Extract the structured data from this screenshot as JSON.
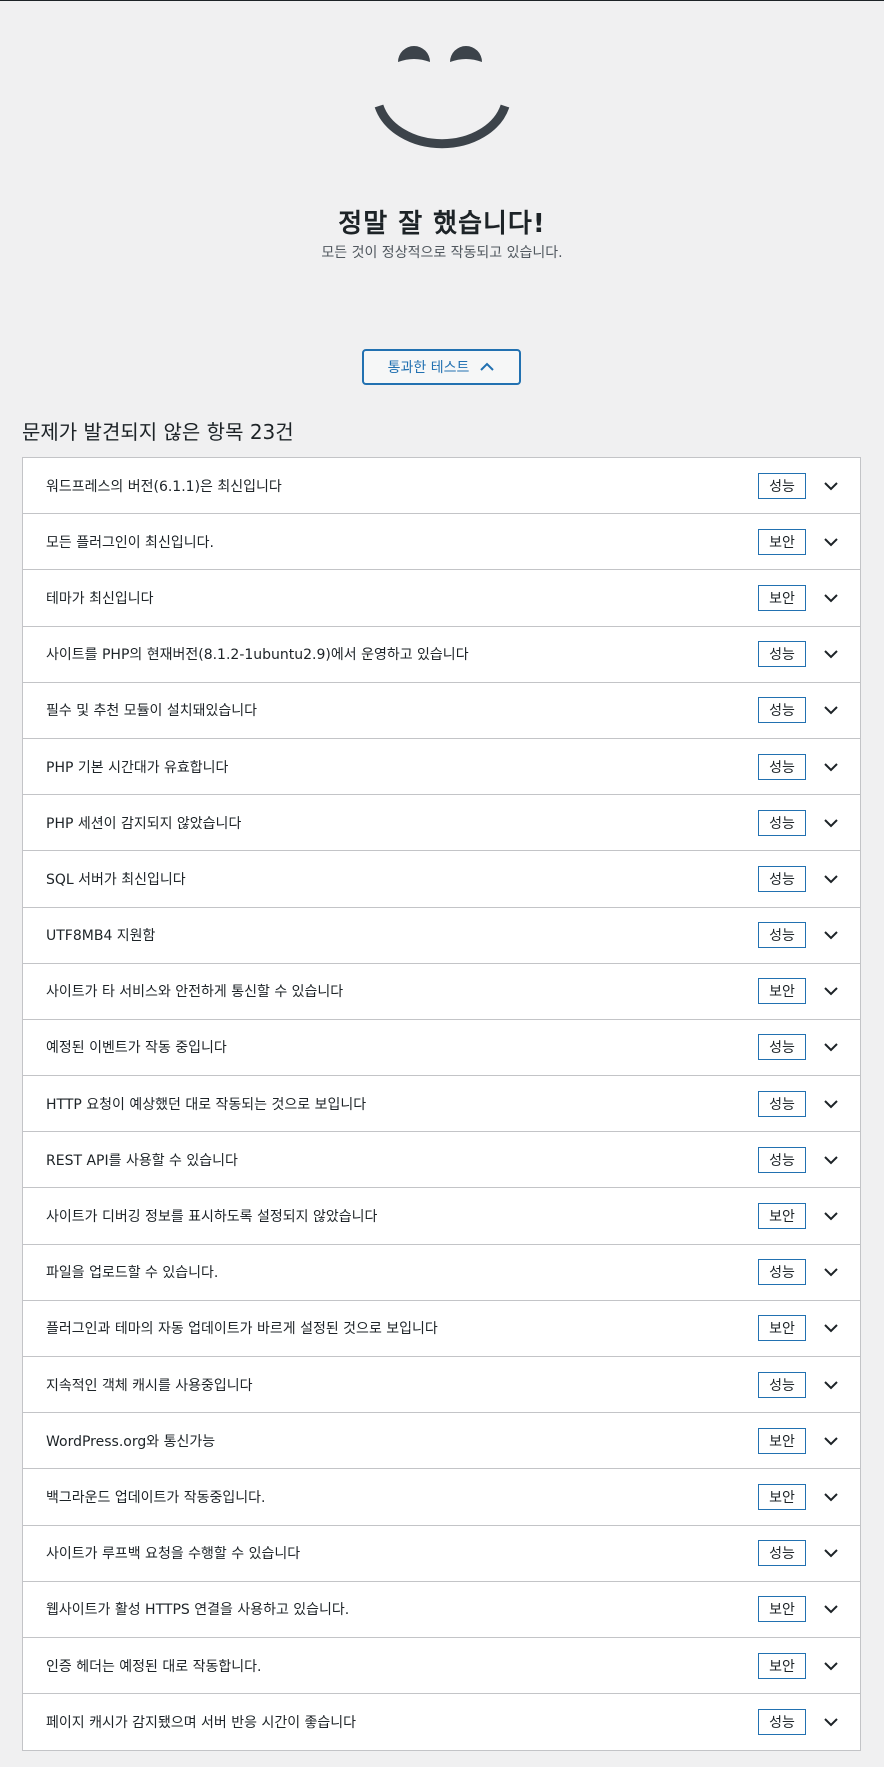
{
  "hero": {
    "title": "정말 잘 했습니다!",
    "subtitle": "모든 것이 정상적으로 작동되고 있습니다.",
    "icon": "smiley-icon"
  },
  "toggle_button": {
    "label": "통과한 테스트",
    "icon": "chevron-up-icon"
  },
  "section": {
    "heading": "문제가 발견되지 않은 항목 23건"
  },
  "colors": {
    "accent": "#2271b1",
    "background": "#f0f0f1",
    "text": "#1d2327",
    "border": "#c3c4c7"
  },
  "items": [
    {
      "label": "워드프레스의 버전(6.1.1)은 최신입니다",
      "badge": "성능"
    },
    {
      "label": "모든 플러그인이 최신입니다.",
      "badge": "보안"
    },
    {
      "label": "테마가 최신입니다",
      "badge": "보안"
    },
    {
      "label": "사이트를 PHP의 현재버전(8.1.2-1ubuntu2.9)에서 운영하고 있습니다",
      "badge": "성능"
    },
    {
      "label": "필수 및 추천 모듈이 설치돼있습니다",
      "badge": "성능"
    },
    {
      "label": "PHP 기본 시간대가 유효합니다",
      "badge": "성능"
    },
    {
      "label": "PHP 세션이 감지되지 않았습니다",
      "badge": "성능"
    },
    {
      "label": "SQL 서버가 최신입니다",
      "badge": "성능"
    },
    {
      "label": "UTF8MB4 지원함",
      "badge": "성능"
    },
    {
      "label": "사이트가 타 서비스와 안전하게 통신할 수 있습니다",
      "badge": "보안"
    },
    {
      "label": "예정된 이벤트가 작동 중입니다",
      "badge": "성능"
    },
    {
      "label": "HTTP 요청이 예상했던 대로 작동되는 것으로 보입니다",
      "badge": "성능"
    },
    {
      "label": "REST API를 사용할 수 있습니다",
      "badge": "성능"
    },
    {
      "label": "사이트가 디버깅 정보를 표시하도록 설정되지 않았습니다",
      "badge": "보안"
    },
    {
      "label": "파일을 업로드할 수 있습니다.",
      "badge": "성능"
    },
    {
      "label": "플러그인과 테마의 자동 업데이트가 바르게 설정된 것으로 보입니다",
      "badge": "보안"
    },
    {
      "label": "지속적인 객체 캐시를 사용중입니다",
      "badge": "성능"
    },
    {
      "label": "WordPress.org와 통신가능",
      "badge": "보안"
    },
    {
      "label": "백그라운드 업데이트가 작동중입니다.",
      "badge": "보안"
    },
    {
      "label": "사이트가 루프백 요청을 수행할 수 있습니다",
      "badge": "성능"
    },
    {
      "label": "웹사이트가 활성 HTTPS 연결을 사용하고 있습니다.",
      "badge": "보안"
    },
    {
      "label": "인증 헤더는 예정된 대로 작동합니다.",
      "badge": "보안"
    },
    {
      "label": "페이지 캐시가 감지됐으며 서버 반응 시간이 좋습니다",
      "badge": "성능"
    }
  ]
}
